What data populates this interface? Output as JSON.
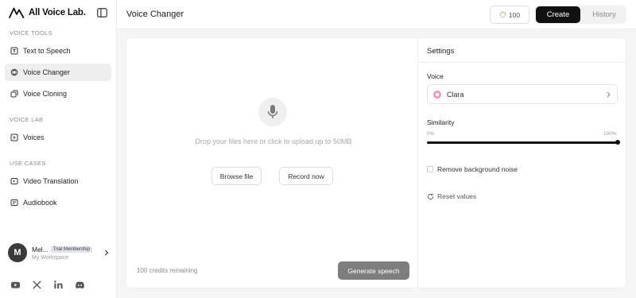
{
  "brand": {
    "name": "All Voice Lab."
  },
  "sidebar": {
    "sections": [
      {
        "label": "VOICE TOOLS"
      },
      {
        "label": "VOICE LAB"
      },
      {
        "label": "USE CASES"
      }
    ],
    "items": [
      {
        "label": "Text to Speech",
        "icon": "text-to-speech-icon",
        "active": false
      },
      {
        "label": "Voice Changer",
        "icon": "voice-changer-icon",
        "active": true
      },
      {
        "label": "Voice Cloning",
        "icon": "voice-cloning-icon",
        "active": false
      },
      {
        "label": "Voices",
        "icon": "voices-icon",
        "active": false
      },
      {
        "label": "Video Translation",
        "icon": "video-translation-icon",
        "active": false
      },
      {
        "label": "Audiobook",
        "icon": "audiobook-icon",
        "active": false
      }
    ],
    "user": {
      "initial": "M",
      "name": "Mel...",
      "badge": "Trial Membership",
      "workspace": "My Workspace"
    },
    "socials": [
      "youtube-icon",
      "x-icon",
      "linkedin-icon",
      "discord-icon"
    ]
  },
  "header": {
    "title": "Voice Changer",
    "credits": "100",
    "tabs": [
      {
        "label": "Create",
        "active": true
      },
      {
        "label": "History",
        "active": false
      }
    ]
  },
  "upload": {
    "drop_text": "Drop your files here or click to upload up to 50MB",
    "browse_label": "Browse file",
    "record_label": "Record now",
    "credits_remaining": "100 credits remaining",
    "generate_label": "Generate speech"
  },
  "settings": {
    "title": "Settings",
    "voice_label": "Voice",
    "voice_value": "Clara",
    "similarity_label": "Similarity",
    "similarity_min": "0%",
    "similarity_max": "100%",
    "similarity_value": 1.0,
    "remove_noise_label": "Remove background noise",
    "remove_noise_checked": false,
    "reset_label": "Reset values"
  },
  "colors": {
    "accent": "#111111",
    "generate_button": "#7d7d7d",
    "voice_dot": "#f47ab0",
    "trial_badge_bg": "#dfe3f0"
  }
}
